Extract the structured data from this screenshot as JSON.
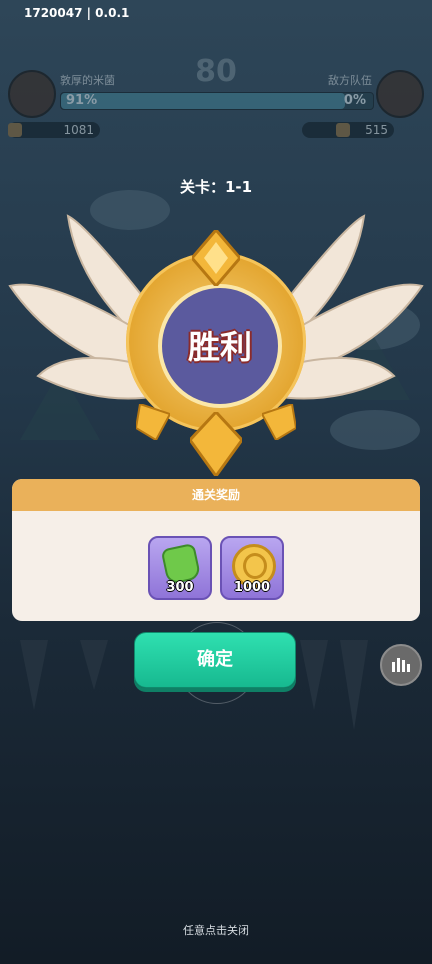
{
  "version": "1720047 | 0.0.1",
  "hud": {
    "score": "80",
    "player_name": "敦厚的米菌",
    "enemy_name": "敌方队伍",
    "player_hp": "91%",
    "player_hp_fraction": 0.91,
    "enemy_hp": "0%",
    "player_power": "1081",
    "enemy_power": "515"
  },
  "level_label": "关卡：1-1",
  "result": "胜利",
  "rewards": {
    "title": "通关奖励",
    "items": [
      {
        "icon": "green-gem-icon",
        "quantity": "300"
      },
      {
        "icon": "gold-coin-icon",
        "quantity": "1000"
      }
    ]
  },
  "confirm_label": "确定",
  "close_hint": "任意点击关闭",
  "colors": {
    "panel_header": "#eab15a",
    "confirm_button": "#22cda0",
    "badge_gold": "#e3a52f",
    "badge_center": "#5b5a9e"
  }
}
